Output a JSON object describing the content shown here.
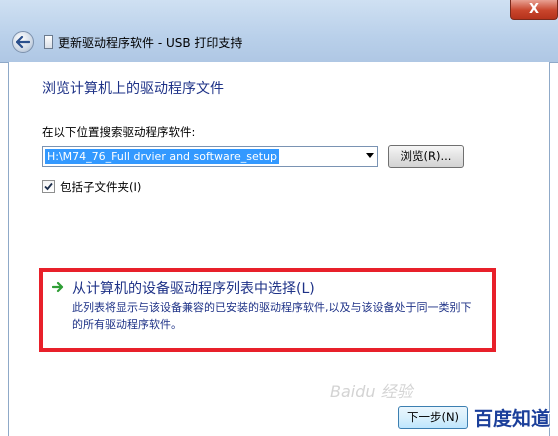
{
  "window": {
    "title": "更新驱动程序软件 - USB 打印支持",
    "close_label": "X"
  },
  "page": {
    "heading": "浏览计算机上的驱动程序文件",
    "search_label": "在以下位置搜索驱动程序软件:",
    "path_value": "H:\\M74_76_Full drvier and software_setup",
    "browse_label": "浏览(R)...",
    "include_subfolders_label": "包括子文件夹(I)",
    "include_subfolders_checked": true
  },
  "option": {
    "title": "从计算机的设备驱动程序列表中选择(L)",
    "description": "此列表将显示与该设备兼容的已安装的驱动程序软件,以及与该设备处于同一类别下的所有驱动程序软件。"
  },
  "footer": {
    "next_label": "下一步(N)"
  },
  "watermark": {
    "text": "Baidu 经验",
    "brand": "百度知道"
  },
  "colors": {
    "link_blue": "#1e3287",
    "highlight_red": "#e8202a",
    "selection_blue": "#3399ff"
  }
}
